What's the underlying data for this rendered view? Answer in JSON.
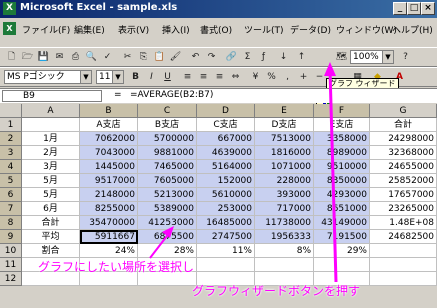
{
  "window": {
    "title": "Microsoft Excel - sample.xls",
    "icon": "excel-icon"
  },
  "menu": [
    "ファイル(F)",
    "編集(E)",
    "表示(V)",
    "挿入(I)",
    "書式(O)",
    "ツール(T)",
    "データ(D)",
    "ウィンドウ(W)",
    "ヘルプ(H)"
  ],
  "toolbar": {
    "zoom": "100%",
    "font": "MS Pゴシック",
    "size": "11",
    "wizard_tooltip": "グラフ ウィザード"
  },
  "formula_bar": {
    "cell_ref": "B9",
    "fx": "=",
    "formula": "=AVERAGE(B2:B7)"
  },
  "columns": [
    "A",
    "B",
    "C",
    "D",
    "E",
    "F",
    "G"
  ],
  "rows": [
    [
      "",
      "A支店",
      "B支店",
      "C支店",
      "D支店",
      "E支店",
      "合計"
    ],
    [
      "1月",
      "7062000",
      "5700000",
      "667000",
      "7513000",
      "3358000",
      "24298000"
    ],
    [
      "2月",
      "7043000",
      "9881000",
      "4639000",
      "1816000",
      "8989000",
      "32368000"
    ],
    [
      "3月",
      "1445000",
      "7465000",
      "5164000",
      "1071000",
      "9510000",
      "24655000"
    ],
    [
      "5月",
      "9517000",
      "7605000",
      "152000",
      "228000",
      "8350000",
      "25852000"
    ],
    [
      "5月",
      "2148000",
      "5213000",
      "5610000",
      "393000",
      "4293000",
      "17657000"
    ],
    [
      "6月",
      "8255000",
      "5389000",
      "253000",
      "717000",
      "8651000",
      "23265000"
    ],
    [
      "合計",
      "35470000",
      "41253000",
      "16485000",
      "11738000",
      "43149000",
      "1.48E+08"
    ],
    [
      "平均",
      "5911667",
      "6875500",
      "2747500",
      "1956333",
      "7191500",
      "24682500"
    ],
    [
      "割合",
      "24%",
      "28%",
      "11%",
      "8%",
      "29%",
      ""
    ],
    [
      "",
      "",
      "",
      "",
      "",
      "",
      ""
    ],
    [
      "",
      "",
      "",
      "",
      "",
      "",
      ""
    ]
  ],
  "annotations": {
    "select_range": "グラフにしたい場所を選択し",
    "press_wizard": "グラフウィザードボタンを押す"
  },
  "colors": {
    "annotation": "#ff00ff",
    "selection": "#c8d0f0",
    "titlebar": "#0a246a"
  }
}
